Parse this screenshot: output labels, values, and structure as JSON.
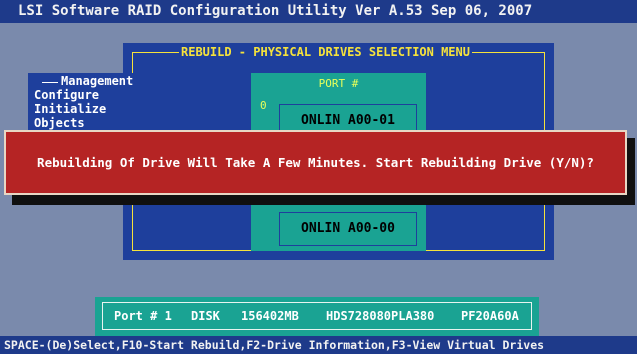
{
  "title_bar": {
    "text": "LSI Software RAID Configuration Utility Ver A.53 Sep 06, 2007"
  },
  "menu": {
    "title": "REBUILD - PHYSICAL DRIVES SELECTION MENU"
  },
  "management": {
    "title": "Management",
    "items": [
      "Configure",
      "Initialize",
      "Objects"
    ]
  },
  "port_panel": {
    "header": "PORT #",
    "index_label": "0",
    "drives": [
      "ONLIN A00-01",
      "ONLIN A00-00"
    ]
  },
  "dialog": {
    "message": "Rebuilding Of Drive Will Take A Few Minutes. Start Rebuilding Drive (Y/N)?"
  },
  "info_bar": {
    "port": "Port # 1",
    "type": "DISK",
    "size": "156402MB",
    "model": "HDS728080PLA380",
    "firmware": "PF20A60A"
  },
  "status_bar": {
    "text": "SPACE-(De)Select,F10-Start Rebuild,F2-Drive Information,F3-View Virtual Drives"
  },
  "colors": {
    "screen_bg": "#7a8aac",
    "window_blue": "#1e3f9c",
    "frame_yellow": "#f5e23c",
    "panel_teal": "#1aa393",
    "dialog_red": "#b52424"
  }
}
